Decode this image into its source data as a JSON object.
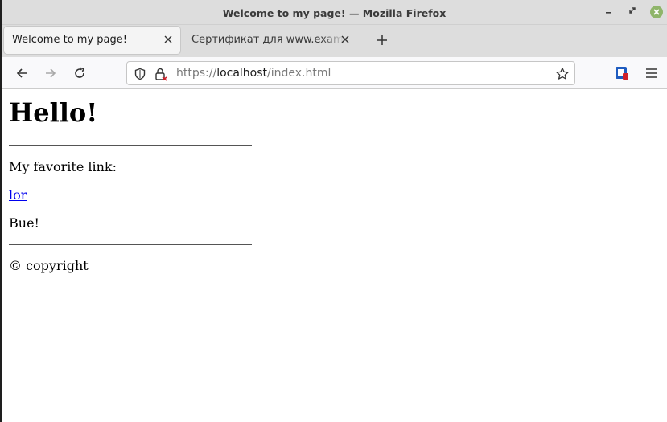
{
  "window": {
    "title": "Welcome to my page! — Mozilla Firefox"
  },
  "tabs": [
    {
      "label": "Welcome to my page!",
      "active": true
    },
    {
      "label": "Сертификат для www.example",
      "active": false
    }
  ],
  "urlbar": {
    "scheme": "https://",
    "host": "localhost",
    "path": "/index.html"
  },
  "icons": {
    "back": "back-arrow-icon",
    "forward": "forward-arrow-icon",
    "reload": "reload-icon",
    "shield": "tracking-protection-shield-icon",
    "lock": "lock-icon",
    "bookmark": "star-icon",
    "extension": "extension-icon",
    "menu": "hamburger-menu-icon"
  },
  "colors": {
    "link": "#0000ee",
    "extension_blue": "#1f5cc0",
    "extension_red": "#d0202a",
    "close_green": "#8fb56a"
  },
  "page": {
    "heading": "Hello!",
    "favorite_text": "My favorite link:",
    "link_text": "lor",
    "bye_text": "Bue!",
    "copyright_text": "© copyright"
  }
}
